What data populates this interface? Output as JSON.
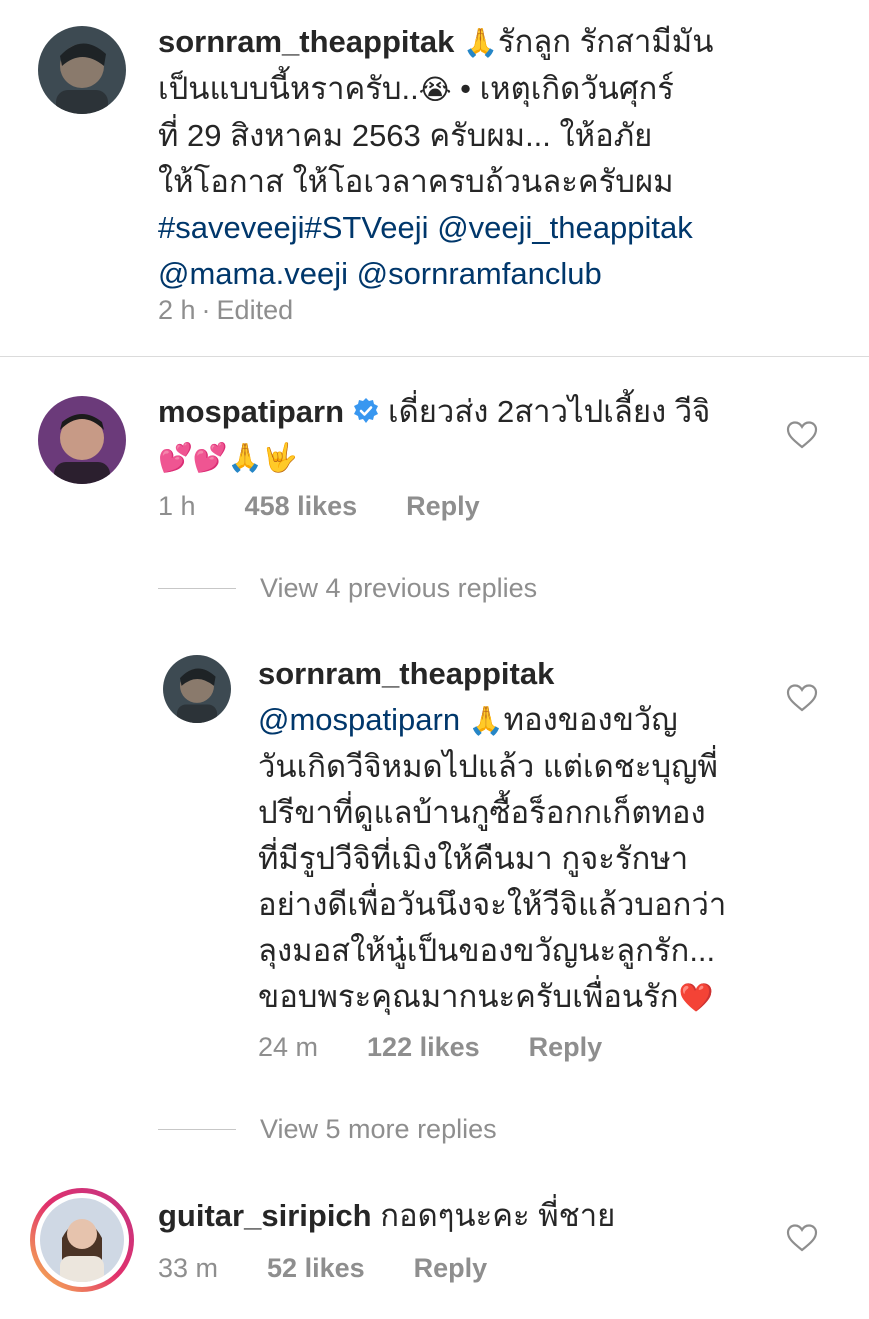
{
  "post": {
    "username": "sornram_theappitak",
    "line1": "รักลูก รักสามีมัน",
    "line2": "เป็นแบบนี้หราครับ..",
    "line2b": " • เหตุเกิดวันศุกร์",
    "line3": "ที่ 29 สิงหาคม 2563  ครับผม... ให้อภัย",
    "line4": "ให้โอกาส ให้โอเวลาครบถ้วนละครับผม",
    "tags": "#saveveeji#STVeeji",
    "mention1": "@veeji_theappitak",
    "mention2": "@mama.veeji",
    "mention3": "@sornramfanclub",
    "time": "2 h",
    "edited": "Edited",
    "emoji_pray": "🙏",
    "emoji_cry": "😭"
  },
  "comment1": {
    "username": "mospatiparn",
    "text1": "เดี่ยวส่ง 2สาวไปเลี้ยง วีจิ",
    "emojis": "💕💕🙏🤟",
    "time": "1 h",
    "likes": "458 likes",
    "reply": "Reply"
  },
  "view_prev": "View 4 previous replies",
  "reply1": {
    "username": "sornram_theappitak",
    "mention": "@mospatiparn",
    "emoji_pray": "🙏",
    "lines": [
      "ทองของขวัญ",
      "วันเกิดวีจิหมดไปแล้ว แต่เดชะบุญพี่",
      "ปรีขาที่ดูแลบ้านกูซื้อร็อกกเก็ตทอง",
      "ที่มีรูปวีจิที่เมิงให้คืนมา กูจะรักษา",
      "อย่างดีเพื่อวันนึงจะให้วีจิแล้วบอกว่า",
      "ลุงมอสให้นู๋เป็นของขวัญนะลูกรัก...",
      "ขอบพระคุณมากนะครับเพื่อนรัก"
    ],
    "heart_emoji": "❤️",
    "time": "24 m",
    "likes": "122 likes",
    "reply": "Reply"
  },
  "view_more": "View 5 more replies",
  "comment2": {
    "username": "guitar_siripich",
    "text": "กอดๆนะคะ พี่ชาย",
    "time": "33 m",
    "likes": "52 likes",
    "reply": "Reply"
  },
  "colors": {
    "text": "#262626",
    "secondary": "#8e8e8e",
    "link": "#00376b",
    "verified": "#3897f0"
  }
}
